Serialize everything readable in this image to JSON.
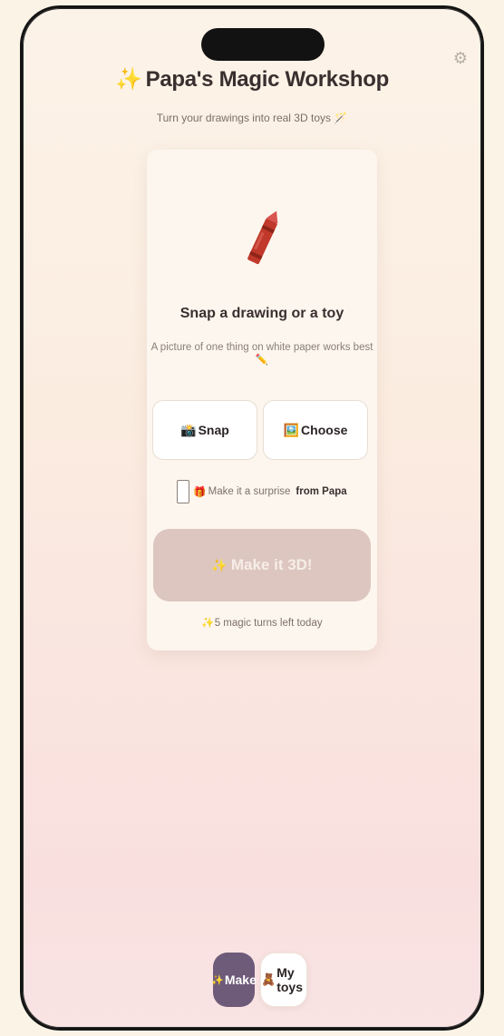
{
  "app": {
    "title": "Papa's Magic Workshop",
    "title_icon": "sparkles",
    "subtitle": "Turn your drawings into real 3D toys",
    "subtitle_icon": "magic-wand",
    "settings_icon": "gear"
  },
  "card": {
    "hero_icon": "crayon",
    "heading": "Snap a drawing or a toy",
    "hint": "A picture of one thing on white paper works best",
    "hint_icon": "pencil",
    "snap_label": "Snap",
    "snap_icon": "camera",
    "choose_label": "Choose",
    "choose_icon": "picture",
    "surprise_label": "Make it a surprise",
    "surprise_from": "from Papa",
    "surprise_icon": "gift",
    "surprise_checked": false,
    "make_label": "Make it 3D!",
    "make_icon": "sparkles",
    "turns_label": "5 magic turns left today",
    "turns_icon": "sparkles"
  },
  "tabs": {
    "make_label": "Make",
    "make_icon": "sparkles",
    "toys_label": "My toys",
    "toys_icon": "teddy-bear",
    "active": "Make"
  },
  "colors": {
    "accent": "#6e5a79",
    "make_button_disabled": "#dcc6bf",
    "background_top": "#fcf3e8",
    "background_bottom": "#f9e3e3",
    "crayon": "#c0392b"
  }
}
